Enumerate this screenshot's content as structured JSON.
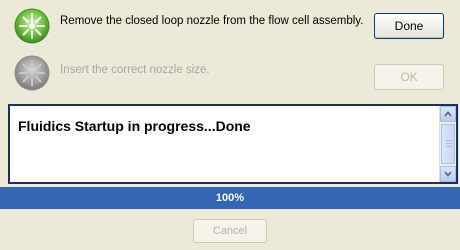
{
  "steps": [
    {
      "text": "Remove the closed loop nozzle from the flow cell assembly.",
      "button": "Done",
      "state": "active",
      "icon": "sparkle-green-icon"
    },
    {
      "text": "Insert the correct nozzle size.",
      "button": "OK",
      "state": "disabled",
      "icon": "sparkle-gray-icon"
    }
  ],
  "log": {
    "text": "Fluidics Startup in progress...Done"
  },
  "progress": {
    "value": 100,
    "label": "100%"
  },
  "footer": {
    "cancel_label": "Cancel"
  },
  "colors": {
    "progress_fill": "#3366b5",
    "active_icon": "#6dbf3a",
    "disabled_icon": "#9a9a9a"
  }
}
